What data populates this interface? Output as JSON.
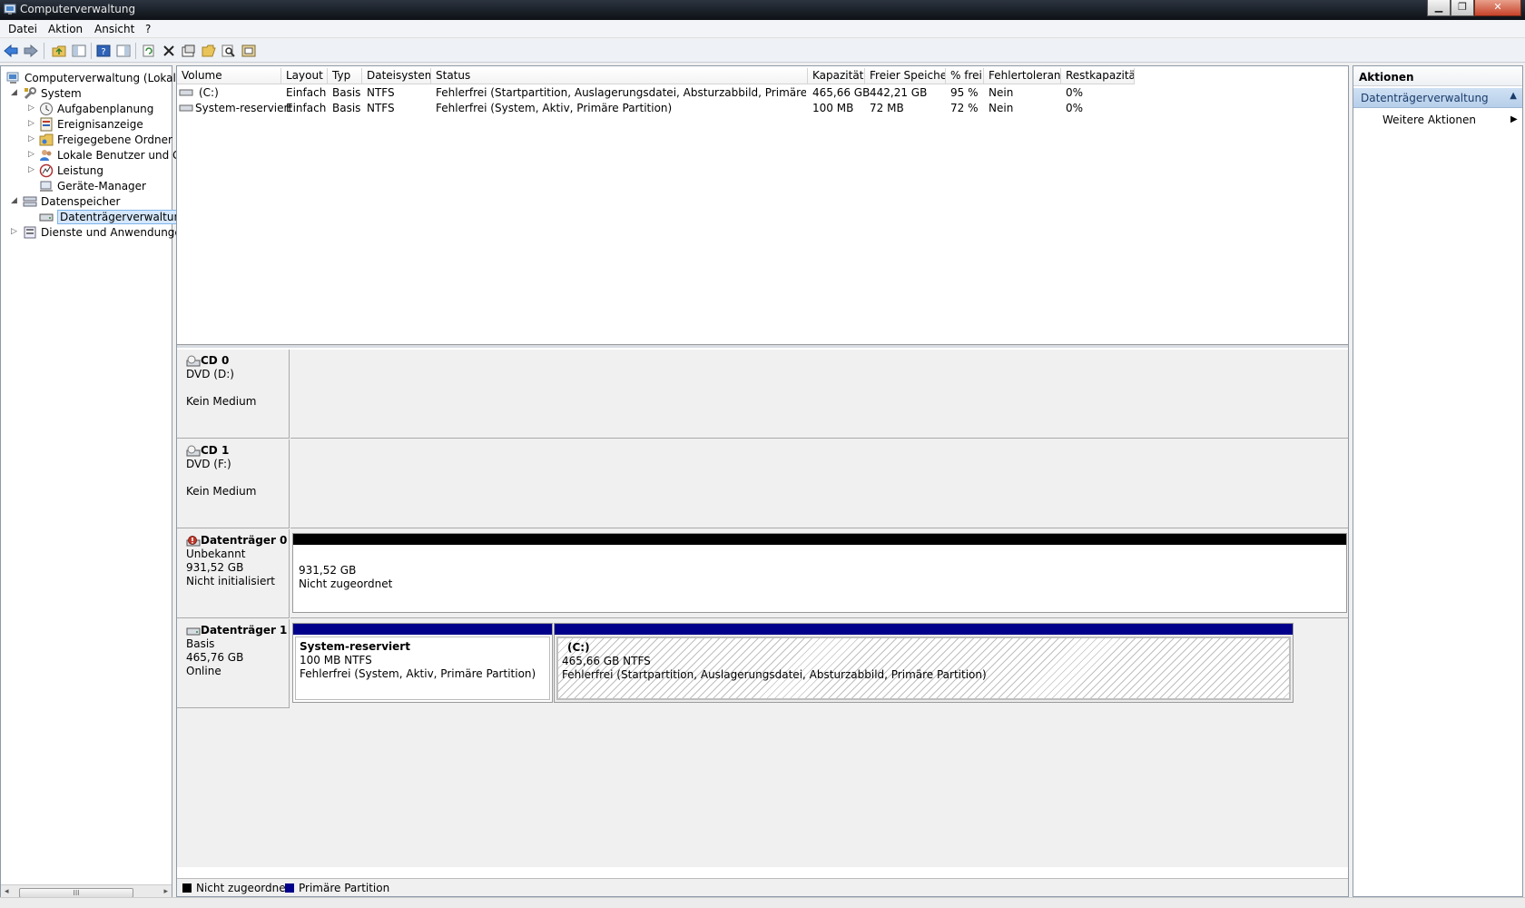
{
  "window": {
    "title": "Computerverwaltung",
    "min": "▁",
    "restore": "❐",
    "close": "✕"
  },
  "menu": [
    "Datei",
    "Aktion",
    "Ansicht",
    "?"
  ],
  "tree": [
    {
      "label": "Computerverwaltung (Lokal)",
      "icon": "computer-management-icon"
    },
    {
      "label": "System",
      "icon": "system-tools-icon"
    },
    {
      "label": "Aufgabenplanung",
      "icon": "task-scheduler-icon"
    },
    {
      "label": "Ereignisanzeige",
      "icon": "event-viewer-icon"
    },
    {
      "label": "Freigegebene Ordner",
      "icon": "shared-folders-icon"
    },
    {
      "label": "Lokale Benutzer und Gr",
      "icon": "local-users-icon"
    },
    {
      "label": "Leistung",
      "icon": "performance-icon"
    },
    {
      "label": "Geräte-Manager",
      "icon": "device-manager-icon"
    },
    {
      "label": "Datenspeicher",
      "icon": "storage-icon"
    },
    {
      "label": "Datenträgerverwaltung",
      "icon": "disk-management-icon"
    },
    {
      "label": "Dienste und Anwendungen",
      "icon": "services-icon"
    }
  ],
  "table": {
    "headers": [
      "Volume",
      "Layout",
      "Typ",
      "Dateisystem",
      "Status",
      "Kapazität",
      "Freier Speicher",
      "% frei",
      "Fehlertoleranz",
      "Restkapazität"
    ],
    "rows": [
      [
        "(C:)",
        "Einfach",
        "Basis",
        "NTFS",
        "Fehlerfrei (Startpartition, Auslagerungsdatei, Absturzabbild, Primäre Partition)",
        "465,66 GB",
        "442,21 GB",
        "95 %",
        "Nein",
        "0%"
      ],
      [
        "System-reserviert",
        "Einfach",
        "Basis",
        "NTFS",
        "Fehlerfrei (System, Aktiv, Primäre Partition)",
        "100 MB",
        "72 MB",
        "72 %",
        "Nein",
        "0%"
      ]
    ]
  },
  "disks": {
    "cd0": {
      "name": "CD 0",
      "type": "DVD (D:)",
      "status": "Kein Medium"
    },
    "cd1": {
      "name": "CD 1",
      "type": "DVD (F:)",
      "status": "Kein Medium"
    },
    "disk0": {
      "name": "Datenträger 0",
      "type": "Unbekannt",
      "size": "931,52 GB",
      "status": "Nicht initialisiert",
      "partition": {
        "size": "931,52 GB",
        "label": "Nicht zugeordnet"
      }
    },
    "disk1": {
      "name": "Datenträger 1",
      "type": "Basis",
      "size": "465,76 GB",
      "status": "Online",
      "p1": {
        "name": "System-reserviert",
        "size": "100 MB NTFS",
        "status": "Fehlerfrei (System, Aktiv, Primäre Partition)"
      },
      "p2": {
        "name": "(C:)",
        "size": "465,66 GB NTFS",
        "status": "Fehlerfrei (Startpartition, Auslagerungsdatei, Absturzabbild, Primäre Partition)"
      }
    }
  },
  "legend": {
    "unallocated": "Nicht zugeordnet",
    "primary": "Primäre Partition"
  },
  "actions": {
    "title": "Aktionen",
    "section": "Datenträgerverwaltung",
    "more": "Weitere Aktionen"
  },
  "colors": {
    "unallocated": "#000000",
    "primary": "#00008b",
    "selection": "#d5e7fb"
  }
}
